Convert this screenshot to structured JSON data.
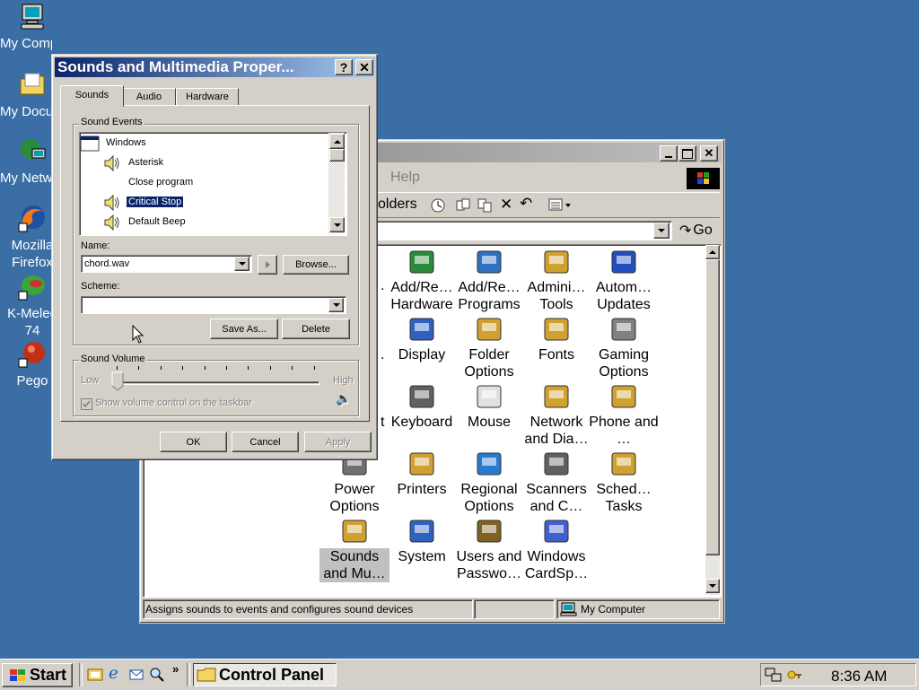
{
  "desktop": {
    "icons": [
      {
        "label": "My Comput",
        "icon": "my-computer-icon"
      },
      {
        "label": "My Docum",
        "icon": "my-documents-icon"
      },
      {
        "label": "My Netw…",
        "icon": "network-icon"
      },
      {
        "label": "Mozilla Firefox",
        "icon": "firefox-icon"
      },
      {
        "label": "K-Meleo 74",
        "icon": "k-meleon-icon"
      },
      {
        "label": "Pego",
        "icon": "pego-icon"
      }
    ]
  },
  "control_panel": {
    "menu_help": "Help",
    "toolbar_folders": "olders",
    "go_label": "Go",
    "items": [
      {
        "label": "Add/Re… Hardware",
        "icon": "add-hardware-icon"
      },
      {
        "label": "Add/Re… Programs",
        "icon": "add-programs-icon"
      },
      {
        "label": "Admini… Tools",
        "icon": "admin-tools-icon"
      },
      {
        "label": "Autom… Updates",
        "icon": "automatic-updates-icon"
      },
      {
        "label": "Display",
        "icon": "display-icon"
      },
      {
        "label": "Folder Options",
        "icon": "folder-options-icon"
      },
      {
        "label": "Fonts",
        "icon": "fonts-icon"
      },
      {
        "label": "Gaming Options",
        "icon": "gaming-options-icon"
      },
      {
        "label": "Keyboard",
        "icon": "keyboard-icon"
      },
      {
        "label": "Mouse",
        "icon": "mouse-icon"
      },
      {
        "label": "Network and Dia…",
        "icon": "network-dialup-icon"
      },
      {
        "label": "Phone and …",
        "icon": "phone-modem-icon"
      },
      {
        "label": "Power Options",
        "icon": "power-options-icon"
      },
      {
        "label": "Printers",
        "icon": "printers-icon"
      },
      {
        "label": "Regional Options",
        "icon": "regional-options-icon"
      },
      {
        "label": "Scanners and C…",
        "icon": "scanners-cameras-icon"
      },
      {
        "label": "Sched… Tasks",
        "icon": "scheduled-tasks-icon"
      },
      {
        "label": "Sounds and Mu…",
        "icon": "sounds-multimedia-icon"
      },
      {
        "label": "System",
        "icon": "system-icon"
      },
      {
        "label": "Users and Passwo…",
        "icon": "users-passwords-icon"
      },
      {
        "label": "Windows CardSp…",
        "icon": "cardspace-icon"
      }
    ],
    "partial_left": [
      ".",
      ".",
      "t"
    ],
    "status_text": "Assigns sounds to events and configures sound devices",
    "status_zone": "My Computer"
  },
  "dialog": {
    "title": "Sounds and Multimedia Proper...",
    "help_btn": "?",
    "close_btn": "✕",
    "tabs": [
      "Sounds",
      "Audio",
      "Hardware"
    ],
    "sound_events_label": "Sound Events",
    "events": [
      {
        "label": "Windows",
        "selected": false,
        "has_sound": false
      },
      {
        "label": "Asterisk",
        "selected": false,
        "has_sound": true
      },
      {
        "label": "Close program",
        "selected": false,
        "has_sound": false
      },
      {
        "label": "Critical Stop",
        "selected": true,
        "has_sound": true
      },
      {
        "label": "Default Beep",
        "selected": false,
        "has_sound": true
      }
    ],
    "name_label": "Name:",
    "name_value": "chord.wav",
    "browse": "Browse...",
    "scheme_label": "Scheme:",
    "scheme_value": "",
    "save_as": "Save As...",
    "delete": "Delete",
    "volume_label": "Sound Volume",
    "volume_low": "Low",
    "volume_high": "High",
    "volume_level": 0,
    "show_volume_label": "Show volume control on the taskbar",
    "ok": "OK",
    "cancel": "Cancel",
    "apply": "Apply"
  },
  "taskbar": {
    "start": "Start",
    "task": "Control Panel",
    "clock": "8:36 AM"
  }
}
